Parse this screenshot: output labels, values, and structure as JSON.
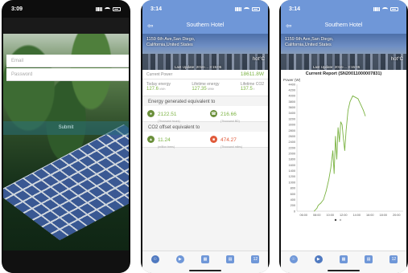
{
  "screen1": {
    "time": "3:09",
    "email_placeholder": "Email",
    "password_placeholder": "Password",
    "submit_label": "Submit"
  },
  "screen2": {
    "time": "3:14",
    "title": "Southern Hotel",
    "address_line1": "1159 6th Ave,San Diego,",
    "address_line2": "California,United States",
    "temperature": "hot°C",
    "last_update": "Last Update: 2016-... 3:15:05",
    "current_power_label": "Current Power",
    "current_power_value": "18611.8W",
    "today_energy_label": "Today energy",
    "today_energy_value": "127.6",
    "today_energy_unit": "kWh",
    "lifetime_energy_label": "Lifetime energy",
    "lifetime_energy_value": "127.35",
    "lifetime_energy_unit": "MWh",
    "lifetime_co2_label": "Lifetime CO2",
    "lifetime_co2_value": "137.5",
    "lifetime_co2_unit": "t",
    "energy_equiv_heading": "Energy generated equivalent to",
    "bulb_value": "2122.51",
    "bulb_unit": "(Thousand hours)",
    "phone_value": "216.66",
    "phone_unit": "(Thousand BD)",
    "co2_heading": "CO2 offset equivalent to",
    "tree_value": "11.24",
    "tree_unit": "(million trees)",
    "car_value": "474.27",
    "car_unit": "(Thousand miles)"
  },
  "screen3": {
    "time": "3:14",
    "title": "Southern Hotel",
    "address_line1": "1159 6th Ave,San Diego,",
    "address_line2": "California,United States",
    "temperature": "hot°C",
    "last_update": "Last Update: 2016-... 3:15:05"
  },
  "tabs": [
    "overview-icon",
    "play-icon",
    "calendar-day-icon",
    "calendar-month-icon",
    "calendar-year-icon"
  ],
  "colors": {
    "header": "#6f97d8",
    "accent": "#7bb342",
    "warn": "#e05a3a"
  },
  "chart_data": {
    "type": "line",
    "title": "Current Report (SN20011000007831)",
    "ylabel": "Power (W)",
    "xlabel": "",
    "ylim": [
      0,
      4400
    ],
    "yticks": [
      0,
      200,
      400,
      600,
      800,
      1000,
      1200,
      1400,
      1600,
      1800,
      2000,
      2200,
      2400,
      2600,
      2800,
      3000,
      3200,
      3400,
      3600,
      3800,
      4000,
      4200,
      4400
    ],
    "xticks": [
      "06:00",
      "08:00",
      "10:00",
      "12:00",
      "14:00",
      "16:00",
      "18:00",
      "20:00"
    ],
    "x_hours": [
      7.6,
      8.0,
      8.2,
      8.6,
      9.0,
      9.4,
      9.8,
      10.1,
      10.4,
      10.6,
      10.8,
      11.0,
      11.2,
      11.4,
      11.6,
      11.8,
      12.0,
      12.2,
      12.4,
      12.7,
      13.0,
      13.4,
      13.8,
      14.2,
      14.6,
      15.0,
      15.3
    ],
    "values": [
      0,
      100,
      200,
      280,
      400,
      700,
      1100,
      1500,
      2100,
      1300,
      2600,
      1800,
      2900,
      2400,
      3100,
      3000,
      2500,
      2100,
      2800,
      3500,
      3800,
      4000,
      3950,
      3900,
      3700,
      3500,
      3300
    ],
    "series_color": "#7bb342"
  }
}
